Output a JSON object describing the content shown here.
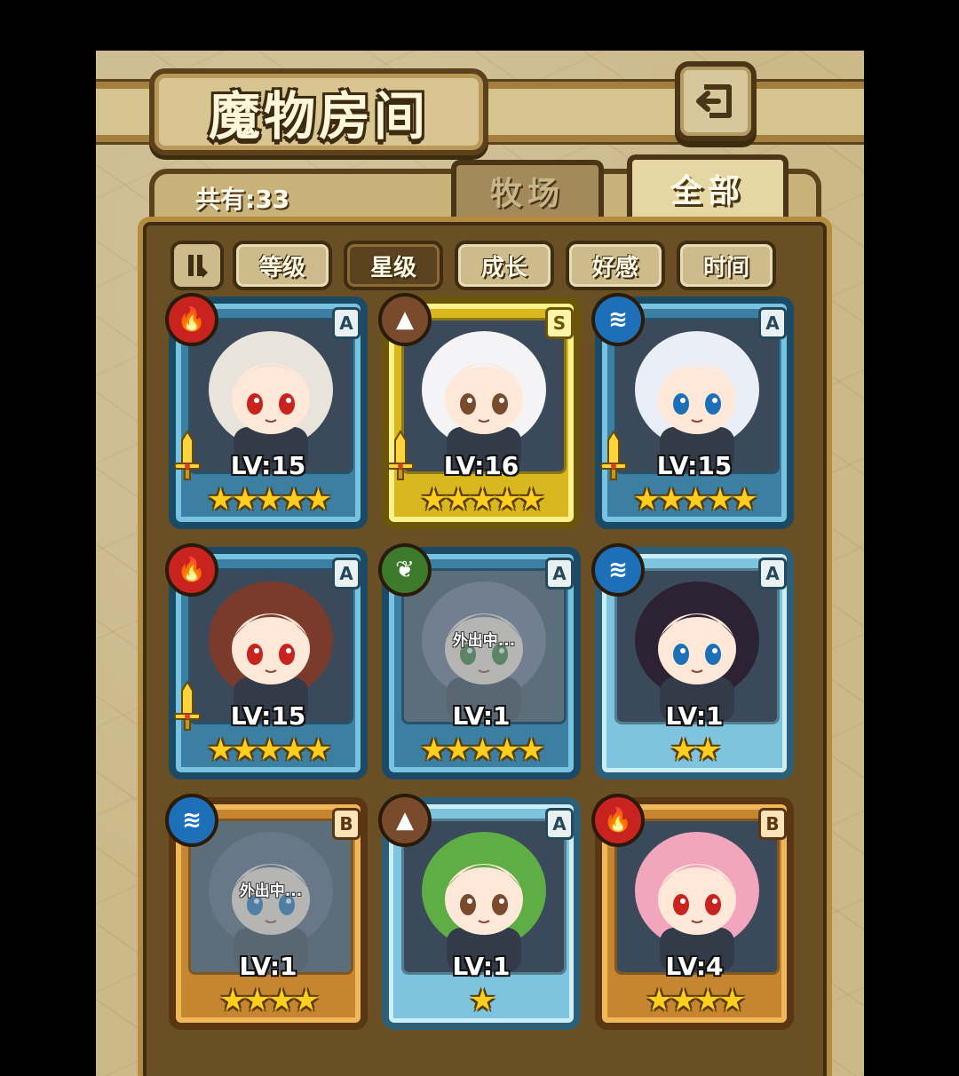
{
  "header": {
    "title": "魔物房间"
  },
  "summary": {
    "count_label": "共有:33"
  },
  "tabs": [
    {
      "label": "牧场",
      "active": false
    },
    {
      "label": "全部",
      "active": true
    }
  ],
  "sort": {
    "options": [
      {
        "label": "等级",
        "active": false
      },
      {
        "label": "星级",
        "active": true
      },
      {
        "label": "成长",
        "active": false
      },
      {
        "label": "好感",
        "active": false
      },
      {
        "label": "时间",
        "active": false
      }
    ]
  },
  "monsters": [
    {
      "level": "LV:15",
      "stars": 5,
      "rank": "A",
      "element": "fire",
      "frame": "blue",
      "status": "",
      "equipped": true
    },
    {
      "level": "LV:16",
      "stars": 5,
      "rank": "S",
      "element": "earth",
      "frame": "gold",
      "status": "",
      "equipped": true
    },
    {
      "level": "LV:15",
      "stars": 5,
      "rank": "A",
      "element": "water",
      "frame": "blue",
      "status": "",
      "equipped": true
    },
    {
      "level": "LV:15",
      "stars": 5,
      "rank": "A",
      "element": "fire",
      "frame": "blue",
      "status": "",
      "equipped": true
    },
    {
      "level": "LV:1",
      "stars": 5,
      "rank": "A",
      "element": "nature",
      "frame": "blue",
      "status": "外出中...",
      "equipped": false
    },
    {
      "level": "LV:1",
      "stars": 2,
      "rank": "A",
      "element": "water",
      "frame": "plain",
      "status": "",
      "equipped": false
    },
    {
      "level": "LV:1",
      "stars": 4,
      "rank": "B",
      "element": "water",
      "frame": "bronze",
      "status": "外出中...",
      "equipped": false
    },
    {
      "level": "LV:1",
      "stars": 1,
      "rank": "A",
      "element": "earth",
      "frame": "plain",
      "status": "",
      "equipped": false
    },
    {
      "level": "LV:4",
      "stars": 4,
      "rank": "B",
      "element": "fire",
      "frame": "bronze",
      "status": "",
      "equipped": false
    }
  ],
  "colors": {
    "fire": "#c8231e",
    "water": "#1d6fb8",
    "earth": "#7a4a2c",
    "nature": "#3d7a2b",
    "star": "#ffce1f"
  }
}
